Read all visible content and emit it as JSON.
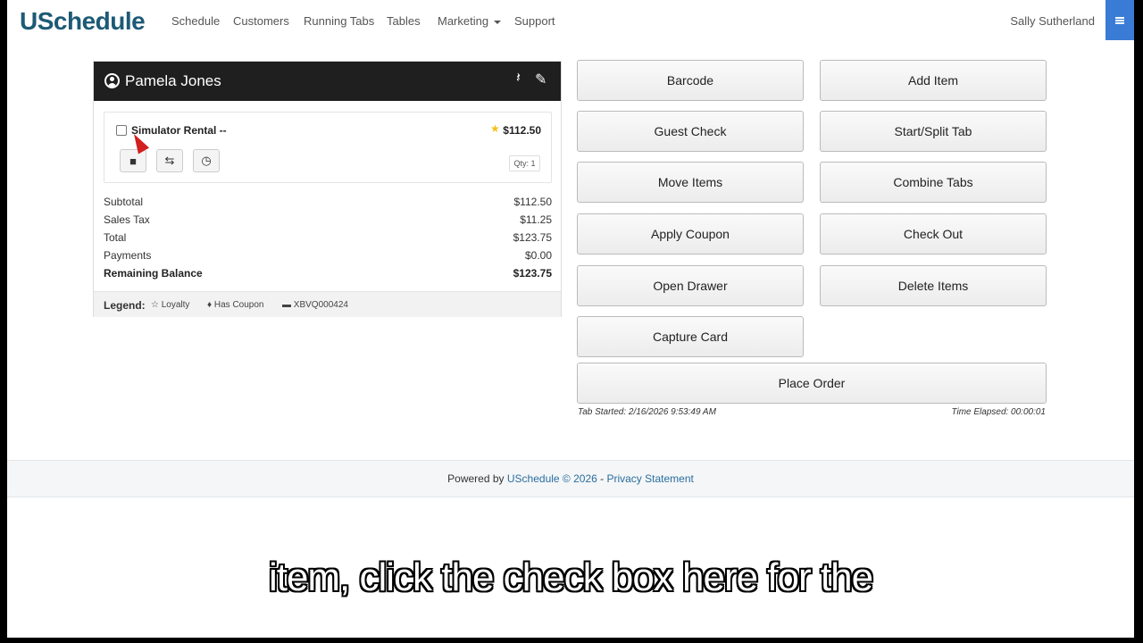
{
  "nav": {
    "brand": "USchedule",
    "items": [
      "Schedule",
      "Customers",
      "Running Tabs",
      "Tables",
      "Marketing",
      "Support"
    ],
    "user": "Sally Sutherland"
  },
  "tab": {
    "customer": "Pamela Jones",
    "item": {
      "name": "Simulator Rental --",
      "price": "$112.50",
      "qty": "Qty: 1"
    },
    "summary": [
      {
        "label": "Subtotal",
        "value": "$112.50"
      },
      {
        "label": "Sales Tax",
        "value": "$11.25"
      },
      {
        "label": "Total",
        "value": "$123.75"
      },
      {
        "label": "Payments",
        "value": "$0.00"
      },
      {
        "label": "Remaining Balance",
        "value": "$123.75"
      }
    ],
    "legend": {
      "title": "Legend:",
      "loyalty": "Loyalty",
      "coupon": "Has Coupon",
      "code": "XBVQ000424"
    }
  },
  "actions": {
    "barcode": "Barcode",
    "add_item": "Add Item",
    "guest_check": "Guest Check",
    "start_split": "Start/Split Tab",
    "move_items": "Move Items",
    "combine_tabs": "Combine Tabs",
    "apply_coupon": "Apply Coupon",
    "check_out": "Check Out",
    "open_drawer": "Open Drawer",
    "delete_items": "Delete Items",
    "capture_card": "Capture Card",
    "place_order": "Place Order"
  },
  "meta": {
    "tab_started": "Tab Started: 2/16/2026 9:53:49 AM",
    "time_elapsed": "Time Elapsed: 00:00:01"
  },
  "footer": {
    "powered": "Powered by",
    "brand_link": "USchedule © 2026",
    "sep": " - ",
    "privacy": "Privacy Statement"
  },
  "caption": "item, click the check box here for the"
}
